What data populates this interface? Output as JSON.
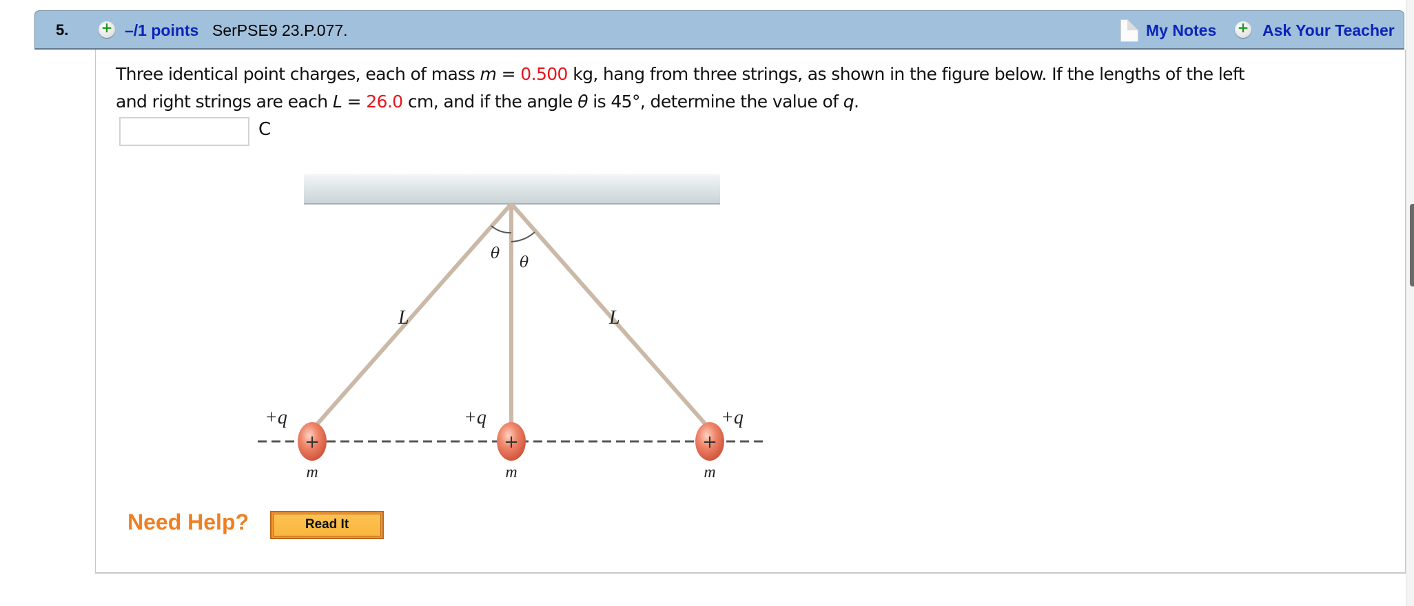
{
  "header": {
    "question_number": "5.",
    "points_label": "–/1 points",
    "problem_code": "SerPSE9 23.P.077.",
    "my_notes_label": "My Notes",
    "ask_teacher_label": "Ask Your Teacher"
  },
  "question": {
    "line1_a": "Three identical point charges, each of mass ",
    "m_var": "m",
    "eq1": " = ",
    "mass_value": "0.500",
    "line1_b": " kg,  hang from three strings, as shown in the figure below. If the lengths of the left",
    "line2_a": "and right strings are each ",
    "L_var": "L",
    "eq2": " = ",
    "length_value": "26.0",
    "line2_b": " cm,  and if the angle ",
    "theta_var": "θ",
    "line2_c": " is 45°, determine the value of ",
    "q_var": "q",
    "line2_d": ".",
    "answer_value": "",
    "answer_unit": "C"
  },
  "figure": {
    "theta_label": "θ",
    "length_label": "L",
    "charge_label": "+q",
    "mass_label": "m",
    "plus_sign": "+"
  },
  "help": {
    "label": "Need Help?",
    "read_it_label": "Read It"
  },
  "colors": {
    "header_bg": "#a0c0dc",
    "link": "#0b24b8",
    "value_red": "#e8141b",
    "help_orange": "#ef7f22"
  }
}
